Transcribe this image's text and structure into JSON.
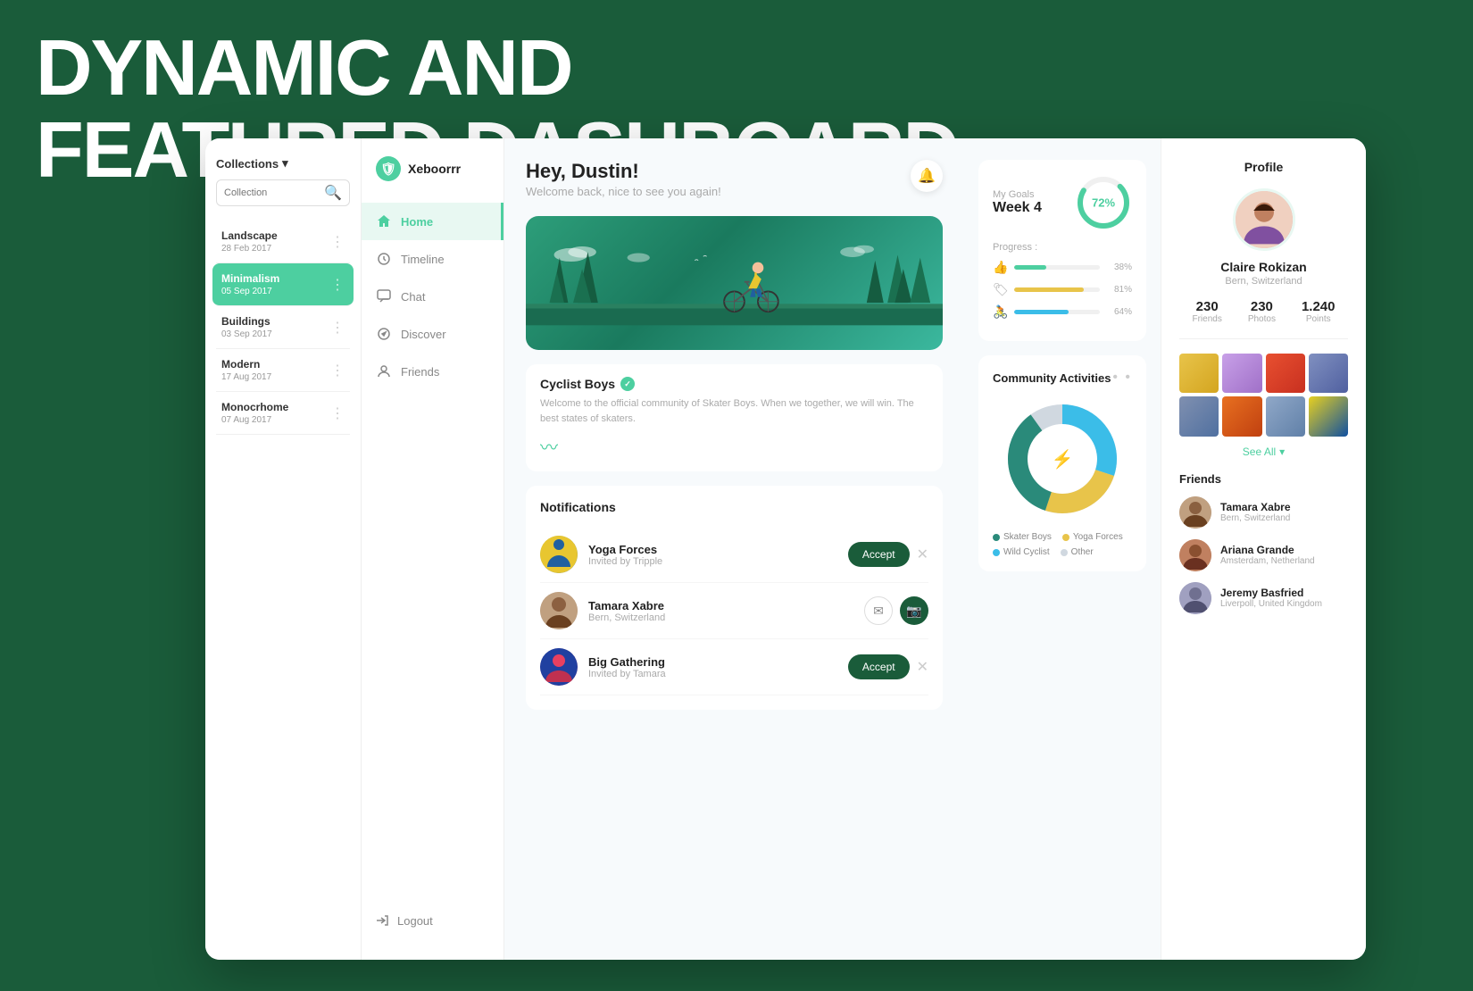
{
  "background_title": {
    "line1": "DYNAMIC AND",
    "line2": "FEATURED DASHBOARD"
  },
  "collection_panel": {
    "title": "Collections",
    "search_placeholder": "Collection",
    "items": [
      {
        "name": "Landscape",
        "date": "28 Feb 2017",
        "active": false
      },
      {
        "name": "Minimalism",
        "date": "05 Sep 2017",
        "active": true
      },
      {
        "name": "Buildings",
        "date": "03 Sep 2017",
        "active": false
      },
      {
        "name": "Modern",
        "date": "17 Aug 2017",
        "active": false
      },
      {
        "name": "Monocrhome",
        "date": "07 Aug 2017",
        "active": false
      }
    ]
  },
  "sidebar": {
    "logo_text": "Xeboorrr",
    "nav_items": [
      {
        "label": "Home",
        "icon": "home",
        "active": true
      },
      {
        "label": "Timeline",
        "icon": "clock",
        "active": false
      },
      {
        "label": "Chat",
        "icon": "chat",
        "active": false
      },
      {
        "label": "Discover",
        "icon": "compass",
        "active": false
      },
      {
        "label": "Friends",
        "icon": "person",
        "active": false
      }
    ],
    "logout_label": "Logout"
  },
  "main": {
    "greeting": "Hey, Dustin!",
    "subtitle": "Welcome back, nice to see you again!",
    "hero": {
      "community_name": "Cyclist Boys",
      "verified": true,
      "description": "Welcome to the official community of Skater Boys. When we together, we will win. The best states of skaters."
    },
    "notifications": {
      "title": "Notifications",
      "items": [
        {
          "name": "Yoga Forces",
          "sub": "Invited by Tripple",
          "type": "invite"
        },
        {
          "name": "Tamara Xabre",
          "sub": "Bern, Switzerland",
          "type": "contact"
        },
        {
          "name": "Big Gathering",
          "sub": "Invited by Tamara",
          "type": "invite"
        }
      ],
      "accept_label": "Accept"
    }
  },
  "goals": {
    "label": "My Goals",
    "week": "Week 4",
    "percentage": "72%",
    "progress_label": "Progress :",
    "bars": [
      {
        "pct": 38,
        "color": "#4dcfa0"
      },
      {
        "pct": 81,
        "color": "#e8c44a"
      },
      {
        "pct": 64,
        "color": "#3bbde8"
      }
    ]
  },
  "community_activities": {
    "title": "Community Activities",
    "segments": [
      {
        "label": "Skater Boys",
        "color": "#2a8a7a",
        "pct": 35
      },
      {
        "label": "Yoga Forces",
        "color": "#e8c44a",
        "pct": 25
      },
      {
        "label": "Wild Cyclist",
        "color": "#3bbde8",
        "pct": 30
      },
      {
        "label": "Other",
        "color": "#d0d8e0",
        "pct": 10
      }
    ]
  },
  "profile": {
    "title": "Profile",
    "name": "Claire Rokizan",
    "location": "Bern, Switzerland",
    "stats": {
      "friends": {
        "label": "Friends",
        "value": "230"
      },
      "photos": {
        "label": "Photos",
        "value": "230"
      },
      "points": {
        "label": "Points",
        "value": "1.240"
      }
    },
    "see_all_label": "See All",
    "friends_title": "Friends",
    "friends_list": [
      {
        "name": "Tamara Xabre",
        "location": "Bern, Switzerland"
      },
      {
        "name": "Ariana Grande",
        "location": "Amsterdam, Netherland"
      },
      {
        "name": "Jeremy Basfried",
        "location": "Liverpoll, United Kingdom"
      }
    ]
  }
}
